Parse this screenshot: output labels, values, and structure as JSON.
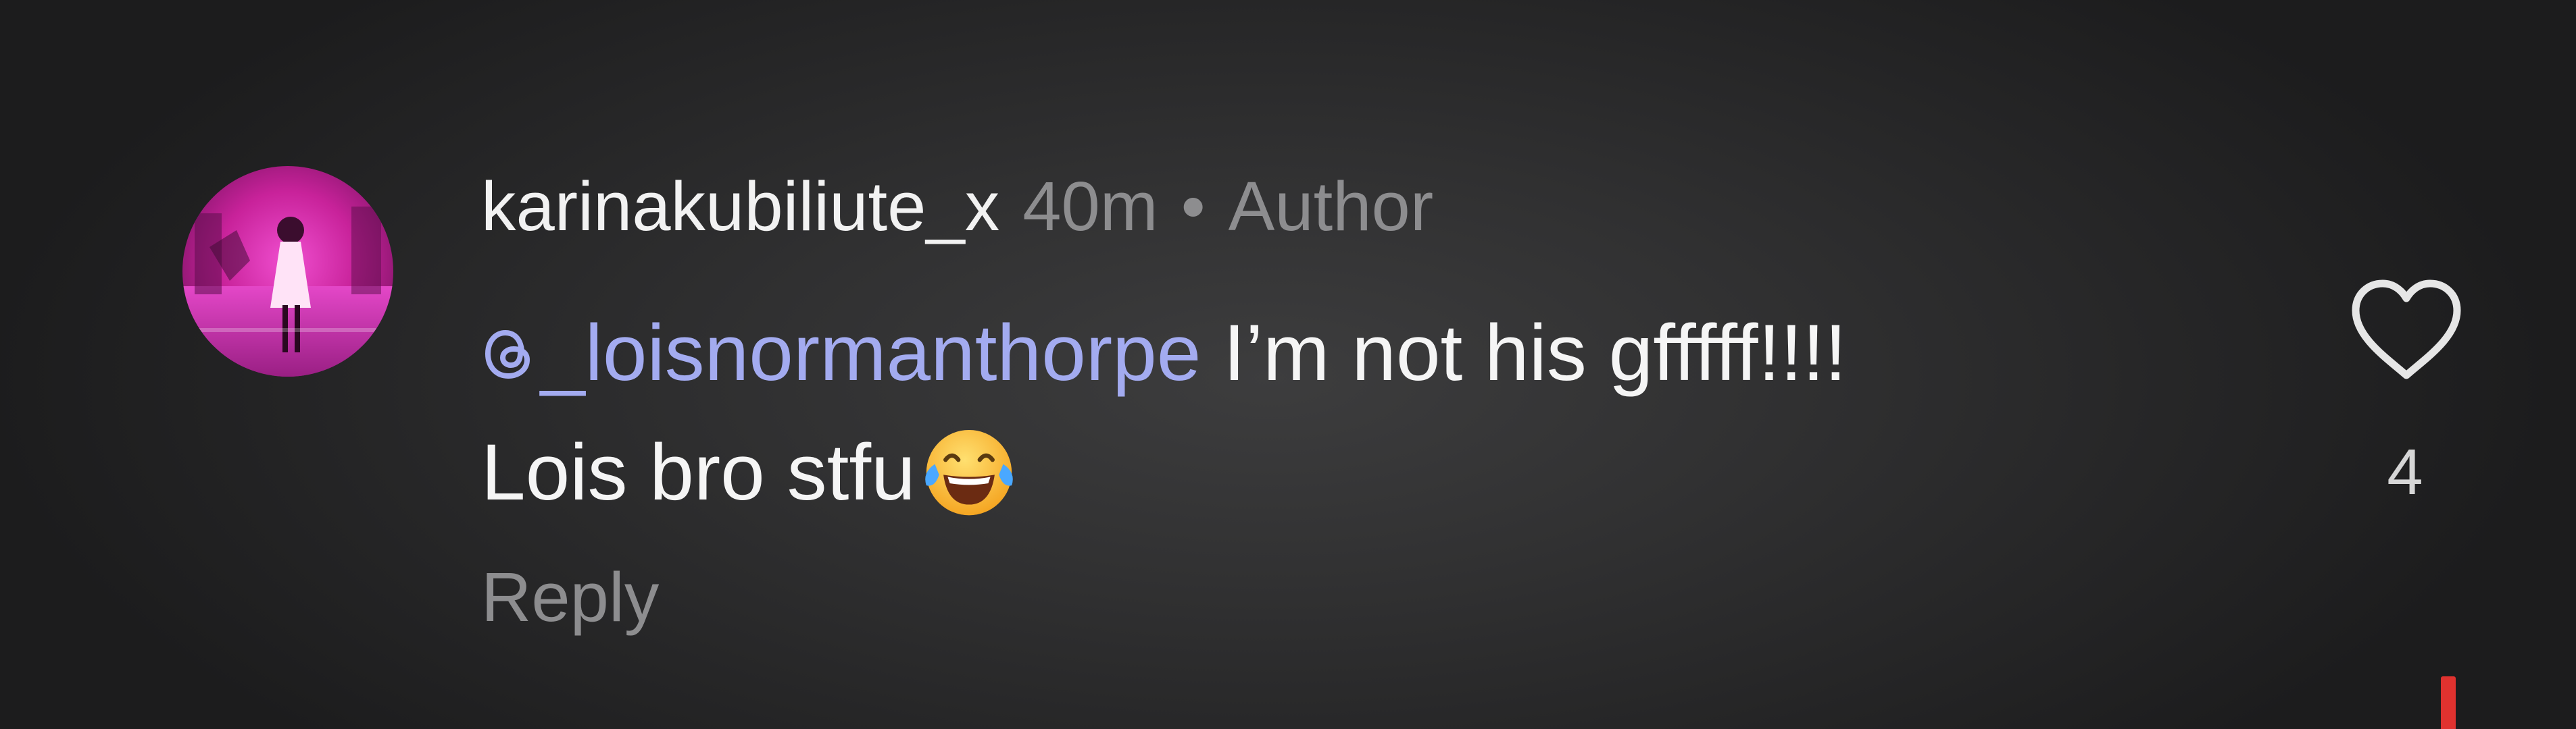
{
  "comment": {
    "username": "karinakubiliute_x",
    "time": "40m",
    "separator": "•",
    "role": "Author",
    "mention": "_loisnormanthorpe",
    "mention_icon": "threads-icon",
    "text_line1": " I’m not his gfffff!!!!",
    "text_line2": "Lois bro stfu",
    "emoji": "face-with-tears-of-joy",
    "reply_label": "Reply",
    "like_icon": "heart-outline-icon",
    "like_count": "4"
  },
  "colors": {
    "background": "#2a2a2b",
    "username": "#f2f2f2",
    "meta": "#8d8d8f",
    "mention": "#a3abf0",
    "body_text": "#f5f5f5",
    "accent_edge": "#e0322f"
  }
}
